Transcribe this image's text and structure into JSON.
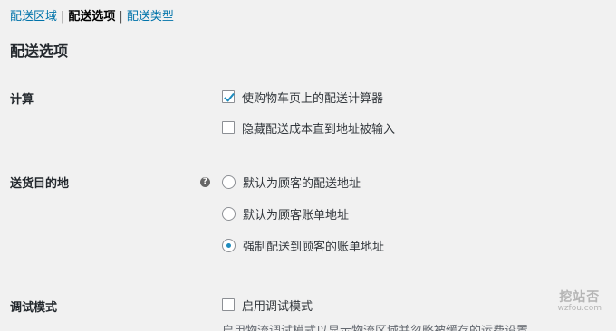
{
  "subnav": {
    "items": [
      "配送区域",
      "配送选项",
      "配送类型"
    ],
    "separator": "|",
    "current_index": 1
  },
  "section_title": "配送选项",
  "calculations": {
    "label": "计算",
    "options": [
      {
        "label": "使购物车页上的配送计算器",
        "checked": true
      },
      {
        "label": "隐藏配送成本直到地址被输入",
        "checked": false
      }
    ]
  },
  "destination": {
    "label": "送货目的地",
    "help_icon": "help-icon",
    "help_glyph": "?",
    "options": [
      {
        "label": "默认为顾客的配送地址",
        "selected": false
      },
      {
        "label": "默认为顾客账单地址",
        "selected": false
      },
      {
        "label": "强制配送到顾客的账单地址",
        "selected": true
      }
    ]
  },
  "debug": {
    "label": "调试模式",
    "option": {
      "label": "启用调试模式",
      "checked": false
    },
    "description": "启用物流调试模式以显示物流区域并忽略被缓存的运费设置"
  },
  "watermark": {
    "cn": "挖站否",
    "en": "wzfou.com"
  },
  "colors": {
    "link": "#0073aa",
    "accent": "#1e8cbe",
    "background": "#f1f1f1"
  }
}
